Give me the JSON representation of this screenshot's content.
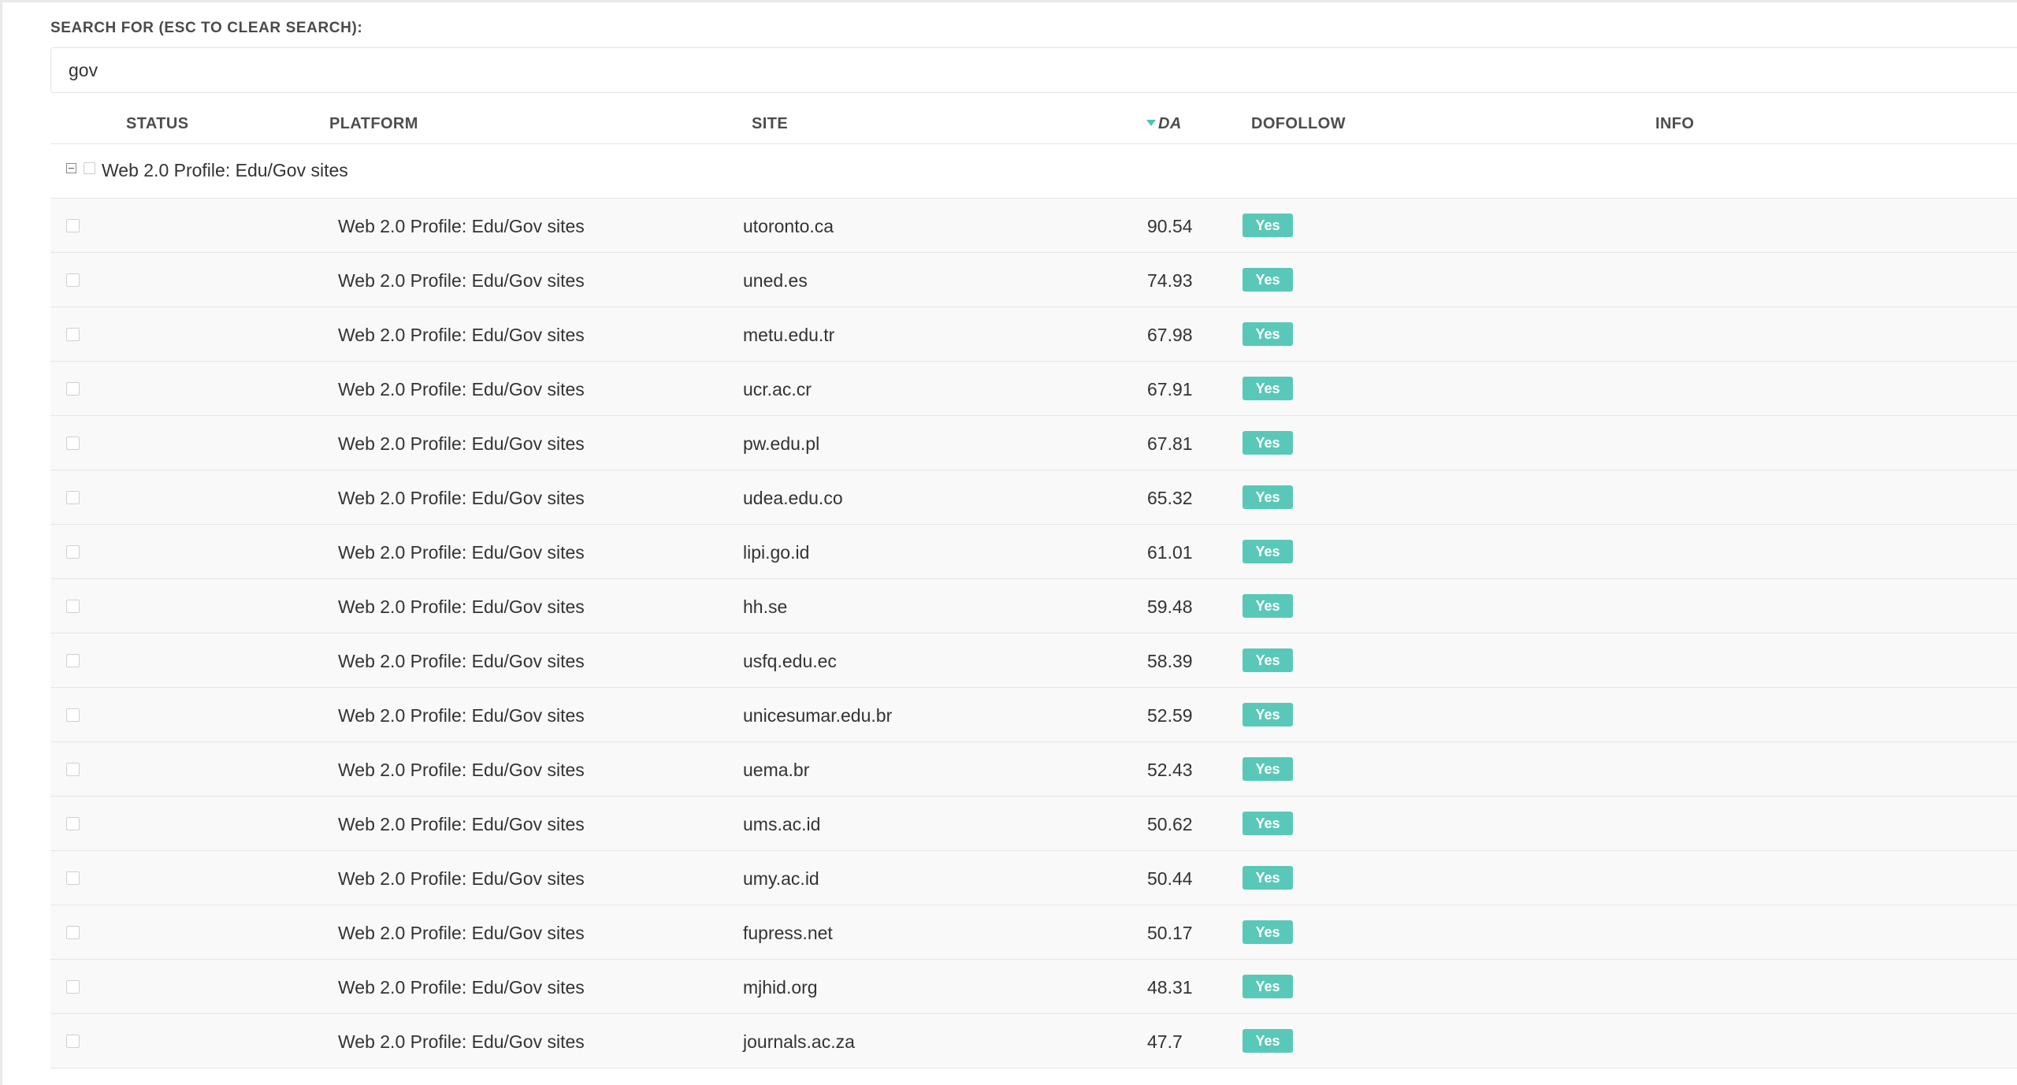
{
  "search": {
    "label": "SEARCH FOR (ESC TO CLEAR SEARCH):",
    "value": "gov"
  },
  "columns": {
    "status": "STATUS",
    "platform": "PLATFORM",
    "site": "SITE",
    "da": "DA",
    "dofollow": "DOFOLLOW",
    "info": "INFO"
  },
  "sort": {
    "column": "DA",
    "direction": "descending",
    "icon": "sort-desc-icon"
  },
  "group": {
    "label": "Web 2.0 Profile: Edu/Gov sites",
    "expanded": true
  },
  "colors": {
    "accent": "#5ac8b8",
    "row_background": "#f9f9f9"
  },
  "rows": [
    {
      "platform": "Web 2.0 Profile: Edu/Gov sites",
      "site": "utoronto.ca",
      "da": "90.54",
      "dofollow": "Yes"
    },
    {
      "platform": "Web 2.0 Profile: Edu/Gov sites",
      "site": "uned.es",
      "da": "74.93",
      "dofollow": "Yes"
    },
    {
      "platform": "Web 2.0 Profile: Edu/Gov sites",
      "site": "metu.edu.tr",
      "da": "67.98",
      "dofollow": "Yes"
    },
    {
      "platform": "Web 2.0 Profile: Edu/Gov sites",
      "site": "ucr.ac.cr",
      "da": "67.91",
      "dofollow": "Yes"
    },
    {
      "platform": "Web 2.0 Profile: Edu/Gov sites",
      "site": "pw.edu.pl",
      "da": "67.81",
      "dofollow": "Yes"
    },
    {
      "platform": "Web 2.0 Profile: Edu/Gov sites",
      "site": "udea.edu.co",
      "da": "65.32",
      "dofollow": "Yes"
    },
    {
      "platform": "Web 2.0 Profile: Edu/Gov sites",
      "site": "lipi.go.id",
      "da": "61.01",
      "dofollow": "Yes"
    },
    {
      "platform": "Web 2.0 Profile: Edu/Gov sites",
      "site": "hh.se",
      "da": "59.48",
      "dofollow": "Yes"
    },
    {
      "platform": "Web 2.0 Profile: Edu/Gov sites",
      "site": "usfq.edu.ec",
      "da": "58.39",
      "dofollow": "Yes"
    },
    {
      "platform": "Web 2.0 Profile: Edu/Gov sites",
      "site": "unicesumar.edu.br",
      "da": "52.59",
      "dofollow": "Yes"
    },
    {
      "platform": "Web 2.0 Profile: Edu/Gov sites",
      "site": "uema.br",
      "da": "52.43",
      "dofollow": "Yes"
    },
    {
      "platform": "Web 2.0 Profile: Edu/Gov sites",
      "site": "ums.ac.id",
      "da": "50.62",
      "dofollow": "Yes"
    },
    {
      "platform": "Web 2.0 Profile: Edu/Gov sites",
      "site": "umy.ac.id",
      "da": "50.44",
      "dofollow": "Yes"
    },
    {
      "platform": "Web 2.0 Profile: Edu/Gov sites",
      "site": "fupress.net",
      "da": "50.17",
      "dofollow": "Yes"
    },
    {
      "platform": "Web 2.0 Profile: Edu/Gov sites",
      "site": "mjhid.org",
      "da": "48.31",
      "dofollow": "Yes"
    },
    {
      "platform": "Web 2.0 Profile: Edu/Gov sites",
      "site": "journals.ac.za",
      "da": "47.7",
      "dofollow": "Yes"
    }
  ]
}
